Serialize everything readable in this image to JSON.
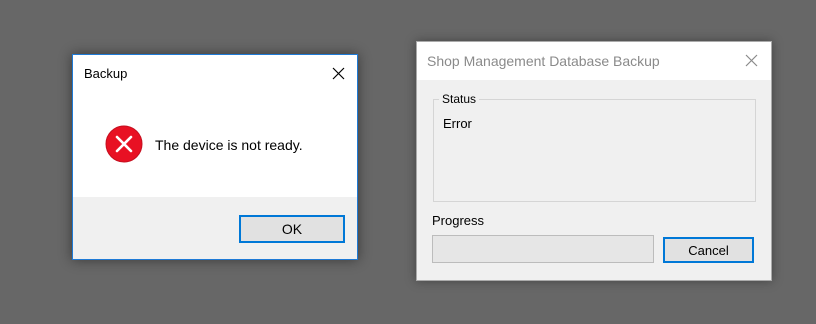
{
  "message_box": {
    "title": "Backup",
    "close_icon": "close-icon",
    "icon": "error-icon",
    "message": "The device is not ready.",
    "ok_label": "OK",
    "accent_color": "#0078d7",
    "error_color": "#e81123"
  },
  "backup_window": {
    "title": "Shop Management Database Backup",
    "close_icon": "close-icon",
    "status_group_label": "Status",
    "status_value": "Error",
    "progress_label": "Progress",
    "progress_value": 0,
    "cancel_label": "Cancel"
  }
}
